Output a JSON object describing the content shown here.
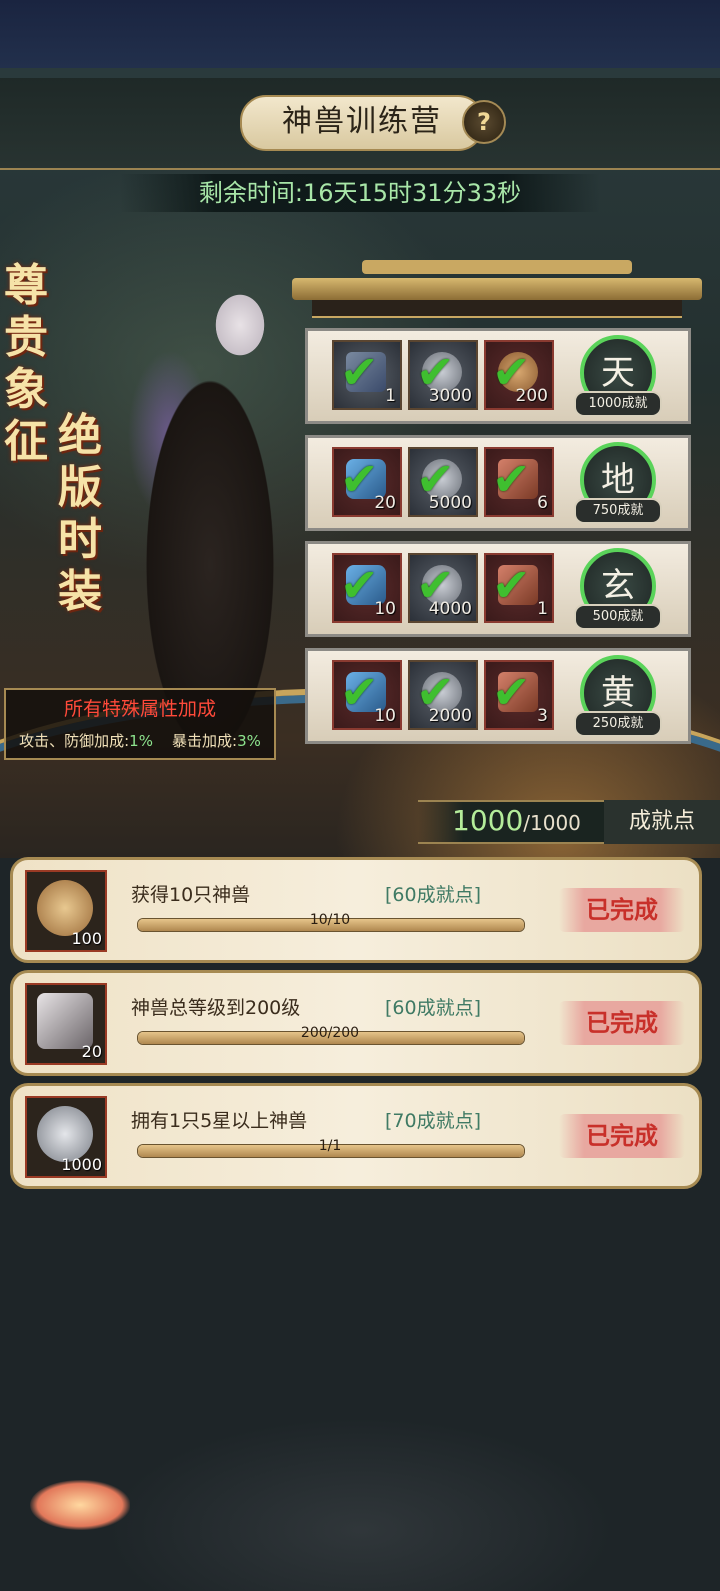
{
  "header": {
    "title": "神兽训练营",
    "help_icon": "question-icon",
    "timer": "剩余时间:16天15时31分33秒"
  },
  "promo": {
    "left_text": "尊贵象征",
    "right_text": "绝版时装",
    "bonus_title": "所有特殊属性加成",
    "bonus_attack_label": "攻击、防御加成:",
    "bonus_attack_value": "1%",
    "bonus_crit_label": "暴击加成:",
    "bonus_crit_value": "3%"
  },
  "tiers": [
    {
      "rank": "天",
      "requirement": "1000成就",
      "items": [
        {
          "icon": "fan-icon",
          "qty": "1"
        },
        {
          "icon": "silver-coin-icon",
          "qty": "3000"
        },
        {
          "icon": "bag-icon",
          "qty": "200"
        }
      ]
    },
    {
      "rank": "地",
      "requirement": "750成就",
      "items": [
        {
          "icon": "blue-scale-icon",
          "qty": "20"
        },
        {
          "icon": "silver-coin-icon",
          "qty": "5000"
        },
        {
          "icon": "stone-icon",
          "qty": "6"
        }
      ]
    },
    {
      "rank": "玄",
      "requirement": "500成就",
      "items": [
        {
          "icon": "blue-scale-icon",
          "qty": "10"
        },
        {
          "icon": "silver-coin-icon",
          "qty": "4000"
        },
        {
          "icon": "stone-icon",
          "qty": "1"
        }
      ]
    },
    {
      "rank": "黄",
      "requirement": "250成就",
      "items": [
        {
          "icon": "blue-scale-icon",
          "qty": "10"
        },
        {
          "icon": "silver-coin-icon",
          "qty": "2000"
        },
        {
          "icon": "stone-icon",
          "qty": "3"
        }
      ]
    }
  ],
  "points": {
    "current": "1000",
    "max": "/1000",
    "label": "成就点"
  },
  "tasks": [
    {
      "icon": "bag-icon",
      "qty": "100",
      "desc": "获得10只神兽",
      "reward": "[60成就点]",
      "progress_text": "10/10",
      "progress": 1.0,
      "status": "已完成"
    },
    {
      "icon": "stone-icon",
      "qty": "20",
      "desc": "神兽总等级到200级",
      "reward": "[60成就点]",
      "progress_text": "200/200",
      "progress": 1.0,
      "status": "已完成"
    },
    {
      "icon": "silver-coin-icon",
      "qty": "1000",
      "desc": "拥有1只5星以上神兽",
      "reward": "[70成就点]",
      "progress_text": "1/1",
      "progress": 1.0,
      "status": "已完成"
    }
  ],
  "colors": {
    "check": "#3fbf2f",
    "done": "#c8302a",
    "accent_gold": "#a68a52"
  }
}
